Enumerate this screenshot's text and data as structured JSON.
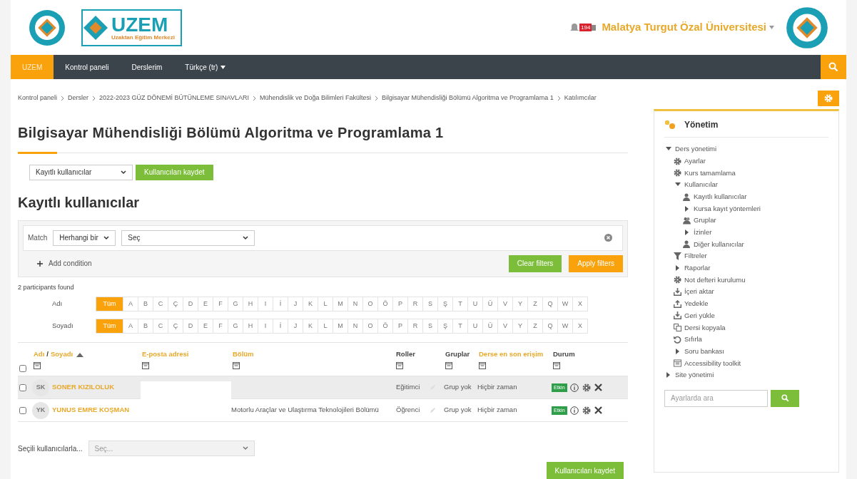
{
  "header": {
    "logo_text": "UZEM",
    "logo_subtitle": "Uzaktan Eğitim Merkezi",
    "notification_count": "194",
    "user_name": "Malatya Turgut Özal Üniversitesi"
  },
  "navbar": {
    "items": [
      {
        "label": "UZEM",
        "selected": true,
        "dropdown": false
      },
      {
        "label": "Kontrol paneli",
        "selected": false,
        "dropdown": false
      },
      {
        "label": "Derslerim",
        "selected": false,
        "dropdown": false
      },
      {
        "label": "Türkçe (tr)",
        "selected": false,
        "dropdown": true
      }
    ]
  },
  "breadcrumb": [
    "Kontrol paneli",
    "Dersler",
    "2022-2023 GÜZ DÖNEMİ BÜTÜNLEME SINAVLARI",
    "Mühendislik ve Doğa Bilimleri Fakültesi",
    "Bilgisayar Mühendisliği Bölümü Algoritma ve Programlama 1",
    "Katılımcılar"
  ],
  "page_title": "Bilgisayar Mühendisliği Bölümü Algoritma ve Programlama 1",
  "enrol_select": {
    "value": "Kayıtlı kullanıcılar"
  },
  "enrol_button": "Kullanıcıları kaydet",
  "section_title": "Kayıtlı kullanıcılar",
  "filters": {
    "match_label": "Match",
    "match_value": "Herhangi bir",
    "condition_value": "Seç",
    "add_condition": "Add condition",
    "clear_button": "Clear filters",
    "apply_button": "Apply filters"
  },
  "participants_count": "2 participants found",
  "initials_bars": [
    {
      "label": "Adı",
      "letters": [
        {
          "text": "Tüm",
          "selected": true
        },
        {
          "text": "A",
          "selected": false
        },
        {
          "text": "B",
          "selected": false
        },
        {
          "text": "C",
          "selected": false
        },
        {
          "text": "Ç",
          "selected": false
        },
        {
          "text": "D",
          "selected": false
        },
        {
          "text": "E",
          "selected": false
        },
        {
          "text": "F",
          "selected": false
        },
        {
          "text": "G",
          "selected": false
        },
        {
          "text": "H",
          "selected": false
        },
        {
          "text": "I",
          "selected": false
        },
        {
          "text": "İ",
          "selected": false
        },
        {
          "text": "J",
          "selected": false
        },
        {
          "text": "K",
          "selected": false
        },
        {
          "text": "L",
          "selected": false
        },
        {
          "text": "M",
          "selected": false
        },
        {
          "text": "N",
          "selected": false
        },
        {
          "text": "O",
          "selected": false
        },
        {
          "text": "Ö",
          "selected": false
        },
        {
          "text": "P",
          "selected": false
        },
        {
          "text": "R",
          "selected": false
        },
        {
          "text": "S",
          "selected": false
        },
        {
          "text": "Ş",
          "selected": false
        },
        {
          "text": "T",
          "selected": false
        },
        {
          "text": "U",
          "selected": false
        },
        {
          "text": "Ü",
          "selected": false
        },
        {
          "text": "V",
          "selected": false
        },
        {
          "text": "Y",
          "selected": false
        },
        {
          "text": "Z",
          "selected": false
        },
        {
          "text": "Q",
          "selected": false
        },
        {
          "text": "W",
          "selected": false
        },
        {
          "text": "X",
          "selected": false
        }
      ]
    },
    {
      "label": "Soyadı",
      "letters": [
        {
          "text": "Tüm",
          "selected": true
        },
        {
          "text": "A",
          "selected": false
        },
        {
          "text": "B",
          "selected": false
        },
        {
          "text": "C",
          "selected": false
        },
        {
          "text": "Ç",
          "selected": false
        },
        {
          "text": "D",
          "selected": false
        },
        {
          "text": "E",
          "selected": false
        },
        {
          "text": "F",
          "selected": false
        },
        {
          "text": "G",
          "selected": false
        },
        {
          "text": "H",
          "selected": false
        },
        {
          "text": "I",
          "selected": false
        },
        {
          "text": "İ",
          "selected": false
        },
        {
          "text": "J",
          "selected": false
        },
        {
          "text": "K",
          "selected": false
        },
        {
          "text": "L",
          "selected": false
        },
        {
          "text": "M",
          "selected": false
        },
        {
          "text": "N",
          "selected": false
        },
        {
          "text": "O",
          "selected": false
        },
        {
          "text": "Ö",
          "selected": false
        },
        {
          "text": "P",
          "selected": false
        },
        {
          "text": "R",
          "selected": false
        },
        {
          "text": "S",
          "selected": false
        },
        {
          "text": "Ş",
          "selected": false
        },
        {
          "text": "T",
          "selected": false
        },
        {
          "text": "U",
          "selected": false
        },
        {
          "text": "Ü",
          "selected": false
        },
        {
          "text": "V",
          "selected": false
        },
        {
          "text": "Y",
          "selected": false
        },
        {
          "text": "Z",
          "selected": false
        },
        {
          "text": "Q",
          "selected": false
        },
        {
          "text": "W",
          "selected": false
        },
        {
          "text": "X",
          "selected": false
        }
      ]
    }
  ],
  "table": {
    "select_all_checked": false,
    "columns": [
      {
        "labels": [
          "Adı",
          "Soyadı"
        ],
        "separator": "/",
        "sortable": true,
        "sorted": true
      },
      {
        "labels": [
          "E-posta adresi"
        ],
        "sortable": true,
        "sorted": false
      },
      {
        "labels": [
          "Bölüm"
        ],
        "sortable": true,
        "sorted": false
      },
      {
        "labels": [
          "Roller"
        ],
        "sortable": false,
        "sorted": false
      },
      {
        "labels": [
          "Gruplar"
        ],
        "sortable": false,
        "sorted": false
      },
      {
        "labels": [
          "Derse en son erişim"
        ],
        "sortable": true,
        "sorted": false
      },
      {
        "labels": [
          "Durum"
        ],
        "sortable": false,
        "sorted": false
      }
    ],
    "rows": [
      {
        "checked": false,
        "highlighted": true,
        "initials": "SK",
        "name": "SONER KIZILOLUK",
        "email_redacted": true,
        "role": "Eğitimci",
        "groups": "Grup yok",
        "last_access": "Hiçbir zaman",
        "status": "Etkin"
      },
      {
        "checked": false,
        "highlighted": false,
        "initials": "YK",
        "name": "YUNUS EMRE KOŞMAN",
        "email_redacted": false,
        "department": "Motorlu Araçlar ve Ulaştırma Teknolojileri Bölümü",
        "role": "Öğrenci",
        "groups": "Grup yok",
        "last_access": "Hiçbir zaman",
        "status": "Etkin"
      }
    ]
  },
  "bulk_action": {
    "label": "Seçili kullanıcılarla...",
    "placeholder": "Seç..."
  },
  "bottom_button": "Kullanıcıları kaydet",
  "admin_block": {
    "title": "Yönetim",
    "search_placeholder": "Ayarlarda ara",
    "tree": [
      {
        "kind": "branch",
        "label": "Ders yönetimi",
        "expanded": true,
        "children": [
          {
            "kind": "gear",
            "label": "Ayarlar"
          },
          {
            "kind": "gear",
            "label": "Kurs tamamlama"
          },
          {
            "kind": "branch",
            "label": "Kullanıcılar",
            "expanded": true,
            "children": [
              {
                "kind": "person",
                "label": "Kayıtlı kullanıcılar"
              },
              {
                "kind": "branch",
                "label": "Kursa kayıt yöntemleri",
                "expanded": false
              },
              {
                "kind": "people",
                "label": "Gruplar"
              },
              {
                "kind": "branch",
                "label": "İzinler",
                "expanded": false
              },
              {
                "kind": "person",
                "label": "Diğer kullanıcılar"
              }
            ]
          },
          {
            "kind": "funnel",
            "label": "Filtreler"
          },
          {
            "kind": "branch",
            "label": "Raporlar",
            "expanded": false
          },
          {
            "kind": "gear",
            "label": "Not defteri kurulumu"
          },
          {
            "kind": "download",
            "label": "İçeri aktar"
          },
          {
            "kind": "upload",
            "label": "Yedekle"
          },
          {
            "kind": "download",
            "label": "Geri yükle"
          },
          {
            "kind": "copy",
            "label": "Dersi kopyala"
          },
          {
            "kind": "reset",
            "label": "Sıfırla"
          },
          {
            "kind": "branch",
            "label": "Soru bankası",
            "expanded": false
          },
          {
            "kind": "toolkit",
            "label": "Accessibility toolkit"
          }
        ]
      },
      {
        "kind": "branch",
        "label": "Site yönetimi",
        "expanded": false
      }
    ]
  }
}
